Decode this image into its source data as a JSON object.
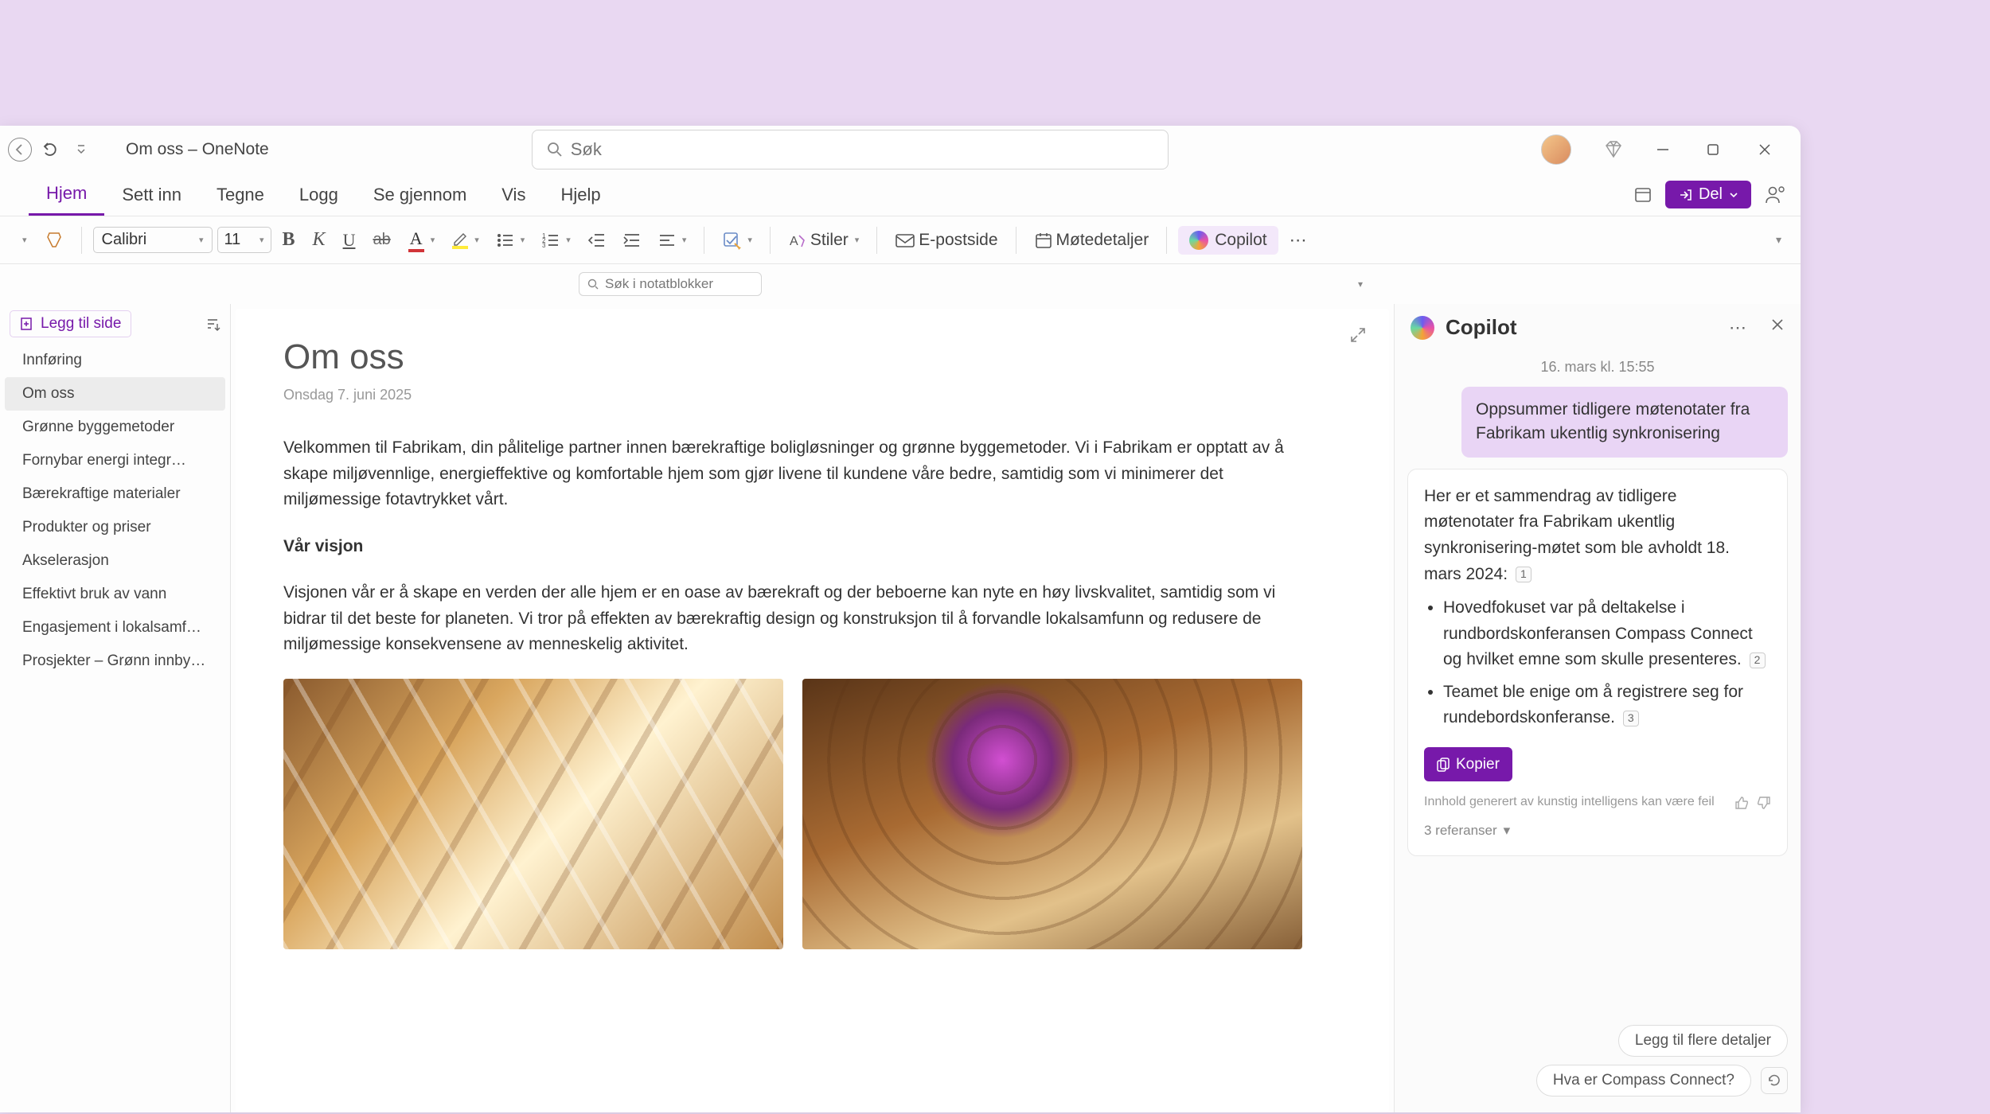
{
  "title": "Om oss – OneNote",
  "search_placeholder": "Søk",
  "tabs": {
    "home": "Hjem",
    "insert": "Sett inn",
    "draw": "Tegne",
    "history": "Logg",
    "review": "Se gjennom",
    "view": "Vis",
    "help": "Hjelp"
  },
  "share": "Del",
  "toolbar": {
    "font": "Calibri",
    "size": "11",
    "styles": "Stiler",
    "email": "E-postside",
    "meeting": "Møtedetaljer",
    "copilot": "Copilot"
  },
  "notebooks_search": "Søk i notatblokker",
  "add_page": "Legg til side",
  "pages": [
    "Innføring",
    "Om oss",
    "Grønne byggemetoder",
    "Fornybar energi integr…",
    "Bærekraftige materialer",
    "Produkter og priser",
    "Akselerasjon",
    "Effektivt bruk av vann",
    "Engasjement i lokalsamf…",
    "Prosjekter – Grønn innby…"
  ],
  "page": {
    "title": "Om oss",
    "date": "Onsdag 7. juni 2025",
    "para1": "Velkommen til Fabrikam, din pålitelige partner innen bærekraftige boligløsninger og grønne byggemetoder. Vi i Fabrikam er opptatt av å skape miljøvennlige, energieffektive og komfortable hjem som gjør livene til kundene våre bedre, samtidig som vi minimerer det miljømessige fotavtrykket vårt.",
    "heading1": "Vår visjon",
    "para2": "Visjonen vår er å skape en verden der alle hjem er en oase av bærekraft og der beboerne kan nyte en høy livskvalitet, samtidig som vi bidrar til det beste for planeten. Vi tror på effekten av bærekraftig design og konstruksjon til å forvandle lokalsamfunn og redusere de miljømessige konsekvensene av menneskelig aktivitet."
  },
  "copilot": {
    "title": "Copilot",
    "timestamp": "16. mars kl. 15:55",
    "user_msg": "Oppsummer tidligere møtenotater fra Fabrikam ukentlig synkronisering",
    "intro": "Her er et sammendrag av tidligere møtenotater fra Fabrikam ukentlig synkronisering-møtet som ble avholdt 18. mars 2024:",
    "bullet1": "Hovedfokuset var på deltakelse i rundbordskonferansen Compass Connect og hvilket emne som skulle presenteres.",
    "bullet2": "Teamet ble enige om å registrere seg for rundebordskonferanse.",
    "ref1": "1",
    "ref2": "2",
    "ref3": "3",
    "copy": "Kopier",
    "disclaimer": "Innhold generert av kunstig intelligens kan være feil",
    "refs": "3 referanser",
    "suggestion1": "Legg til flere detaljer",
    "suggestion2": "Hva er Compass Connect?"
  }
}
